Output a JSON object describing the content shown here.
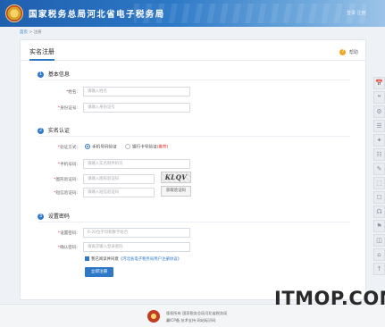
{
  "header": {
    "site_title": "国家税务总局河北省电子税务局",
    "user_text": "登录 注册"
  },
  "breadcrumb": {
    "home": "首页",
    "separator": ">",
    "current": "注册"
  },
  "page": {
    "title": "实名注册",
    "help_icon": "?",
    "help_label": "帮助"
  },
  "sections": {
    "basic": {
      "num": "1",
      "title": "基本信息"
    },
    "verify": {
      "num": "2",
      "title": "实名认证"
    },
    "password": {
      "num": "3",
      "title": "设置密码"
    }
  },
  "basic_fields": {
    "name_label": "姓名:",
    "name_placeholder": "请输入姓名",
    "id_label": "身份证号:",
    "id_placeholder": "请输入身份证号"
  },
  "verify_fields": {
    "method_label": "验证方式:",
    "method_options": [
      "手机号码验证",
      "银行卡号验证"
    ],
    "recommended": "(推荐)",
    "phone_label": "手机号码:",
    "phone_placeholder": "请输入实名制手机号",
    "captcha_label": "图形验证码:",
    "captcha_placeholder": "请输入图形验证码",
    "captcha_text": "KLQV",
    "sms_label": "短信验证码:",
    "sms_placeholder": "请输入短信验证码",
    "sms_button": "获取验证码"
  },
  "password_fields": {
    "pwd_label": "设置密码:",
    "pwd_placeholder": "6-20位字母和数字组合",
    "confirm_label": "确认密码:",
    "confirm_placeholder": "请再次输入登录密码"
  },
  "agreement": {
    "prefix": "我已阅读并同意",
    "link": "《河北省电子税务局用户注册协议》"
  },
  "submit_label": "立即注册",
  "rail_icons": [
    "📅",
    "❝",
    "⚙",
    "☰",
    "✦",
    "☷",
    "✎",
    "⬚",
    "☐",
    "☊",
    "⚑",
    "◫",
    "⌂",
    "↑"
  ],
  "footer": {
    "line1": "版权所有  国家税务总局河北省税务局",
    "line2": "冀ICP备  技术支持  网站标识码"
  },
  "watermark": "ITMOP.COM",
  "colors": {
    "accent": "#2d79c7",
    "required": "#e53935",
    "help": "#f0a824"
  }
}
